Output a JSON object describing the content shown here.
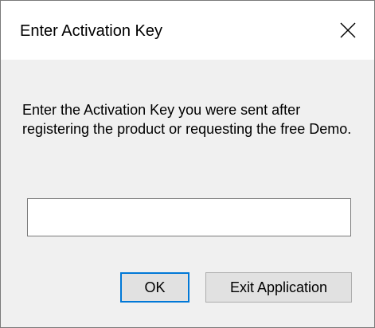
{
  "dialog": {
    "title": "Enter Activation Key",
    "close_icon": "close-icon",
    "message": "Enter the Activation Key you were sent after registering the product or requesting the free Demo.",
    "input": {
      "value": "",
      "placeholder": ""
    },
    "ok_label": "OK",
    "exit_label": "Exit Application"
  },
  "colors": {
    "accent": "#0078d7",
    "window_bg": "#f0f0f0",
    "titlebar_bg": "#ffffff",
    "button_bg": "#e1e1e1"
  }
}
